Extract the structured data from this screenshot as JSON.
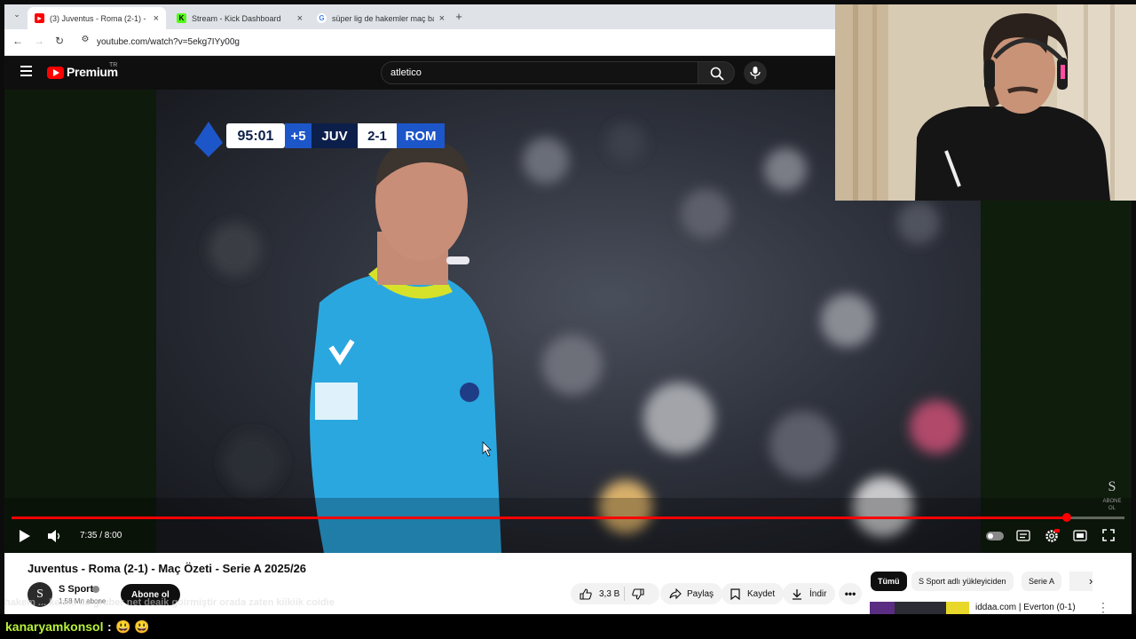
{
  "tabs": [
    {
      "title": "(3) Juventus - Roma (2-1) - Maç",
      "icon": "youtube-favicon",
      "active": true
    },
    {
      "title": "Stream - Kick Dashboard",
      "icon": "kick-favicon",
      "active": false
    },
    {
      "title": "süper lig de hakemler maç başı",
      "icon": "google-favicon",
      "active": false
    }
  ],
  "address": {
    "url": "youtube.com/watch?v=5ekg7IYy00g"
  },
  "yt": {
    "brand": "Premium",
    "region": "TR",
    "search_value": "atletico"
  },
  "scoreboard": {
    "time": "95:01",
    "added": "+5",
    "home": "JUV",
    "score": "2-1",
    "away": "ROM"
  },
  "player": {
    "time_display": "7:35 / 8:00",
    "progress": 0.948,
    "watermark_top": "ABONE",
    "watermark_bottom": "OL"
  },
  "video": {
    "title": "Juventus - Roma (2-1) - Maç Özeti - Serie A 2025/26",
    "channel": "S Sport",
    "subscribers": "1,58 Mn abone",
    "subscribe_label": "Abone ol",
    "likes": "3,3 B",
    "share_label": "Paylaş",
    "save_label": "Kaydet",
    "download_label": "İndir"
  },
  "chips": [
    "Tümü",
    "S Sport adlı yükleyiciden",
    "Serie A"
  ],
  "recommended": {
    "title": "iddaa.com | Everton (0-1)"
  },
  "caption_text": "hakem ... kenks'da gruber net deaik goirmiştir orada zaten kiikiik coidie",
  "chat": {
    "user": "kanaryamkonsol",
    "separator": ":",
    "emotes": "😃 😃"
  },
  "colors": {
    "yt_red": "#ff0000",
    "chat_user": "#b7f23a",
    "serie_a_blue": "#1d56c9"
  }
}
